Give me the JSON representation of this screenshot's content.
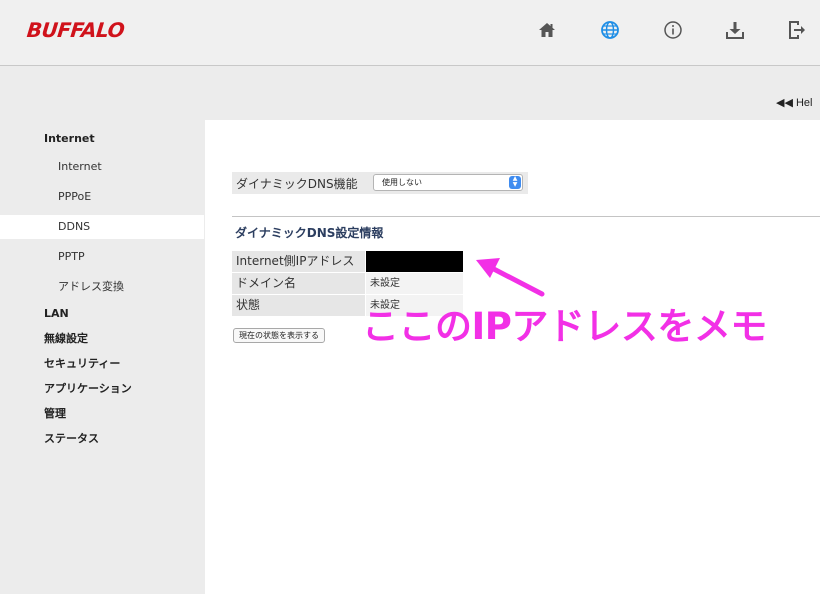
{
  "header": {
    "logo": "BUFFALO",
    "icons": [
      "home-icon",
      "globe-icon",
      "info-icon",
      "download-icon",
      "logout-icon"
    ],
    "accent_color": "#d0121b",
    "globe_color": "#1f8ee6"
  },
  "help_link": "◀◀ Hel",
  "sidebar": {
    "items": [
      {
        "label": "Internet",
        "level": "top"
      },
      {
        "label": "Internet",
        "level": "sub"
      },
      {
        "label": "PPPoE",
        "level": "sub"
      },
      {
        "label": "DDNS",
        "level": "sub",
        "active": true
      },
      {
        "label": "PPTP",
        "level": "sub"
      },
      {
        "label": "アドレス変換",
        "level": "sub"
      },
      {
        "label": "LAN",
        "level": "top"
      },
      {
        "label": "無線設定",
        "level": "top"
      },
      {
        "label": "セキュリティー",
        "level": "top"
      },
      {
        "label": "アプリケーション",
        "level": "top"
      },
      {
        "label": "管理",
        "level": "top"
      },
      {
        "label": "ステータス",
        "level": "top"
      }
    ]
  },
  "main": {
    "ddns_function": {
      "label": "ダイナミックDNS機能",
      "selected": "使用しない"
    },
    "section_title": "ダイナミックDNS設定情報",
    "info_rows": [
      {
        "label": "Internet側IPアドレス",
        "value": ""
      },
      {
        "label": "ドメイン名",
        "value": "未設定"
      },
      {
        "label": "状態",
        "value": "未設定"
      }
    ],
    "status_button": "現在の状態を表示する"
  },
  "annotation": {
    "text": "ここのIPアドレスをメモ",
    "color": "#f230e6"
  }
}
